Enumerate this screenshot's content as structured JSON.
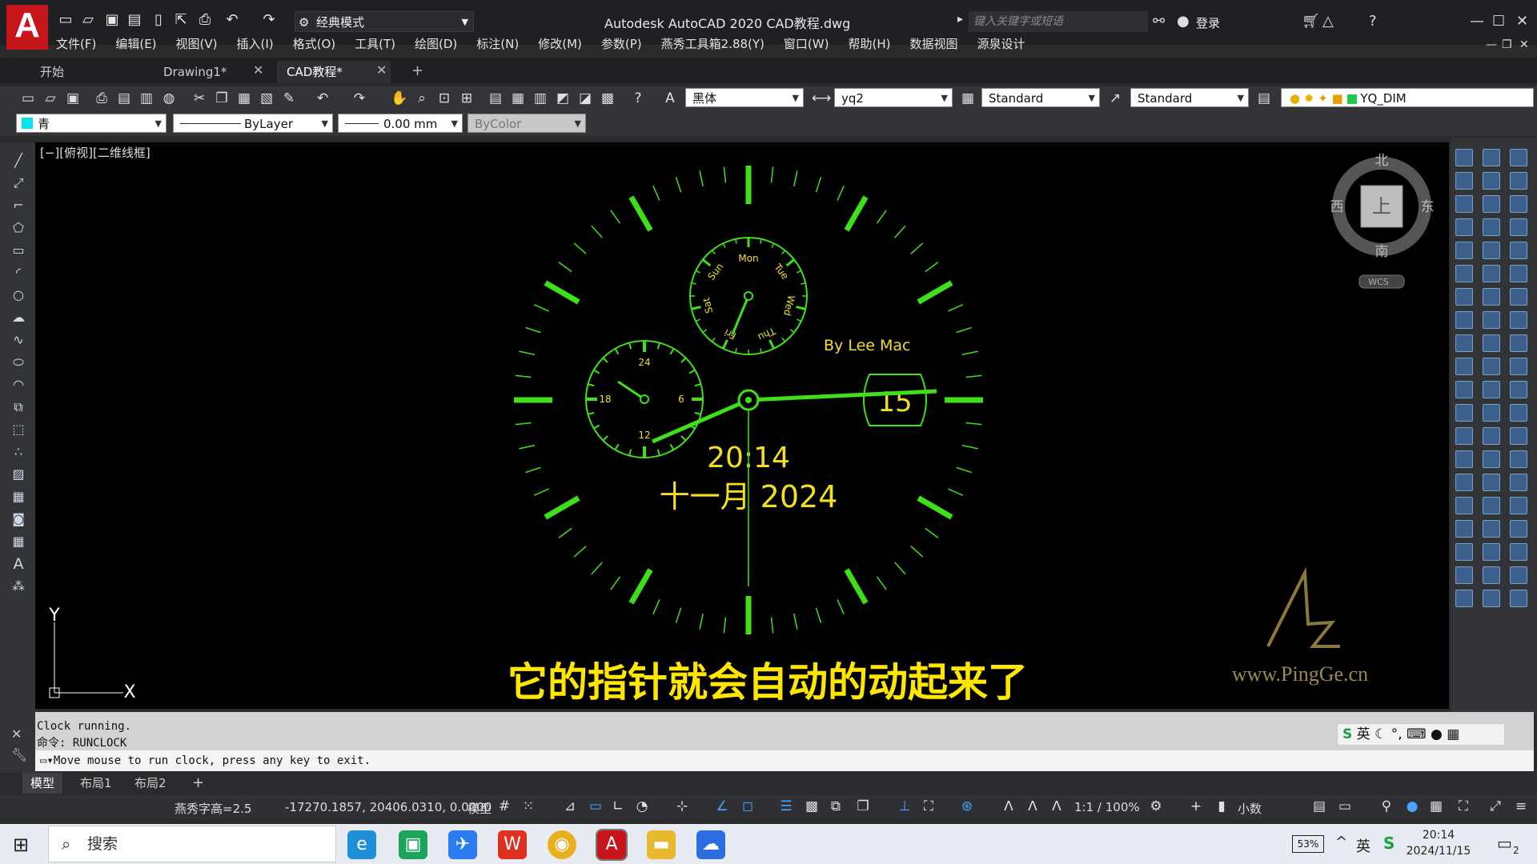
{
  "window": {
    "title": "Autodesk AutoCAD 2020    CAD教程.dwg",
    "workspace": "经典模式",
    "search_placeholder": "键入关键字或短语",
    "login": "登录",
    "logo_letter": "A"
  },
  "menu": [
    "文件(F)",
    "编辑(E)",
    "视图(V)",
    "插入(I)",
    "格式(O)",
    "工具(T)",
    "绘图(D)",
    "标注(N)",
    "修改(M)",
    "参数(P)",
    "燕秀工具箱2.88(Y)",
    "窗口(W)",
    "帮助(H)",
    "数据视图",
    "源泉设计"
  ],
  "tabs": [
    {
      "label": "开始",
      "active": false,
      "closable": false
    },
    {
      "label": "Drawing1*",
      "active": false,
      "closable": true
    },
    {
      "label": "CAD教程*",
      "active": true,
      "closable": true
    }
  ],
  "toolbar": {
    "font": "黑体",
    "text_style": "yq2",
    "dim_style": "Standard",
    "table_style": "Standard",
    "layer": "YQ_DIM",
    "color": "青",
    "linetype": "ByLayer",
    "lineweight": "0.00 mm",
    "plotstyle": "ByColor"
  },
  "viewport_label": "[−][俯视][二维线框]",
  "viewcube": {
    "north": "北",
    "south": "南",
    "east": "东",
    "west": "西",
    "top": "上",
    "ucs": "WCS"
  },
  "clock": {
    "author": "By Lee Mac",
    "date_box": "15",
    "time": "20:14",
    "month_year": "十一月  2024",
    "days": [
      "Mon",
      "Tue",
      "Wed",
      "Thu",
      "Fri",
      "Sat",
      "Sun"
    ],
    "hours24": [
      "24",
      "6",
      "12",
      "18"
    ]
  },
  "subtitle": "它的指针就会自动的动起来了",
  "watermark": {
    "logo": "PG",
    "url": "www.PingGe.cn"
  },
  "ucs_icon": {
    "x": "X",
    "y": "Y"
  },
  "command": {
    "line1": "Clock running.",
    "line2": "命令: RUNCLOCK",
    "prompt": "Move mouse to run clock, press any key to exit."
  },
  "ime": {
    "lang": "英"
  },
  "layout_tabs": [
    "模型",
    "布局1",
    "布局2"
  ],
  "status": {
    "text_height": "燕秀字高=2.5",
    "coords": "-17270.1857, 20406.0310, 0.0000",
    "space": "模型",
    "scale": "1:1 / 100%",
    "units": "小数"
  },
  "taskbar": {
    "search": "搜索",
    "battery": "53%",
    "lang": "英",
    "time": "20:14",
    "date": "2024/11/15",
    "notif": "2"
  },
  "colors": {
    "clock_green": "#3fe01a",
    "clock_yellow": "#f0e020",
    "subtitle": "#ffe600",
    "accent": "#c6151b"
  }
}
